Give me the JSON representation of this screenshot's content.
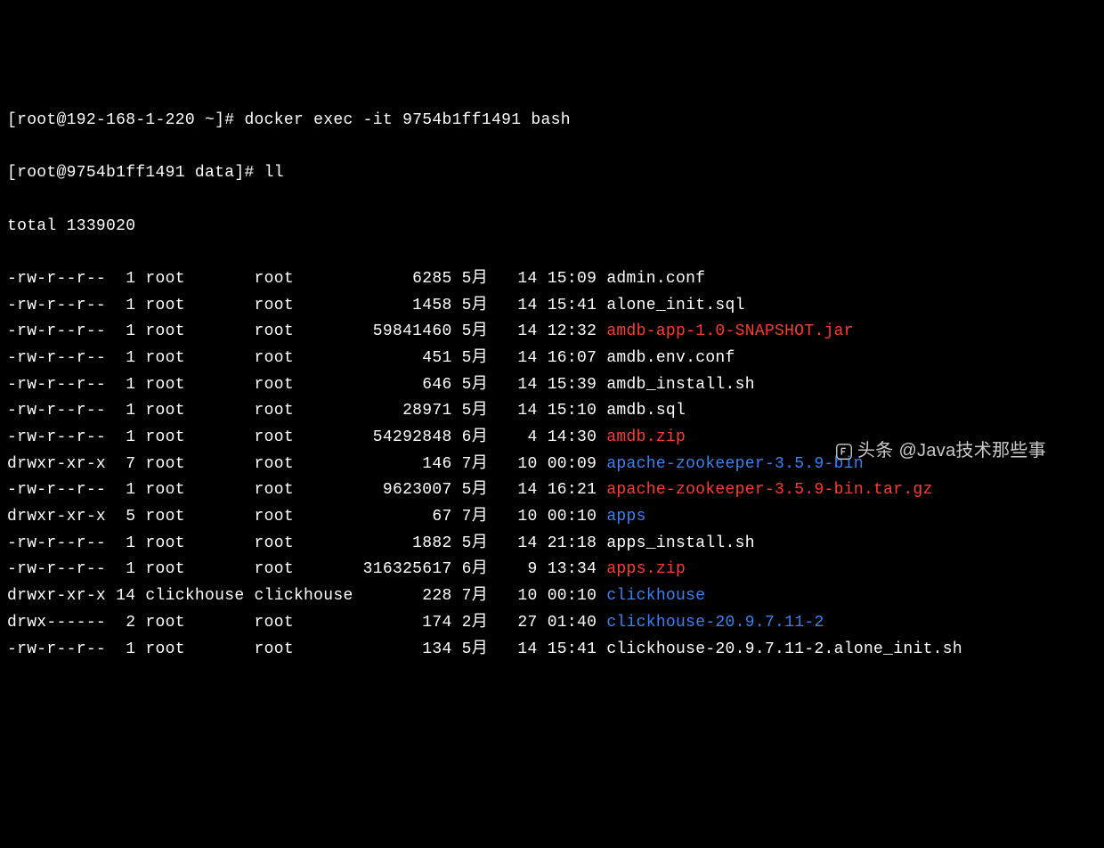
{
  "prompt1": "[root@192-168-1-220 ~]# docker exec -it 9754b1ff1491 bash",
  "prompt2": "[root@9754b1ff1491 data]# ll",
  "total": "total 1339020",
  "rows": [
    {
      "perm": "-rw-r--r--",
      "links": "1",
      "owner": "root",
      "group": "root",
      "size": "6285",
      "month": "5月",
      "day": "14",
      "time": "15:09",
      "name": "admin.conf",
      "color": ""
    },
    {
      "perm": "-rw-r--r--",
      "links": "1",
      "owner": "root",
      "group": "root",
      "size": "1458",
      "month": "5月",
      "day": "14",
      "time": "15:41",
      "name": "alone_init.sql",
      "color": ""
    },
    {
      "perm": "-rw-r--r--",
      "links": "1",
      "owner": "root",
      "group": "root",
      "size": "59841460",
      "month": "5月",
      "day": "14",
      "time": "12:32",
      "name": "amdb-app-1.0-SNAPSHOT.jar",
      "color": "red"
    },
    {
      "perm": "-rw-r--r--",
      "links": "1",
      "owner": "root",
      "group": "root",
      "size": "451",
      "month": "5月",
      "day": "14",
      "time": "16:07",
      "name": "amdb.env.conf",
      "color": ""
    },
    {
      "perm": "-rw-r--r--",
      "links": "1",
      "owner": "root",
      "group": "root",
      "size": "646",
      "month": "5月",
      "day": "14",
      "time": "15:39",
      "name": "amdb_install.sh",
      "color": ""
    },
    {
      "perm": "-rw-r--r--",
      "links": "1",
      "owner": "root",
      "group": "root",
      "size": "28971",
      "month": "5月",
      "day": "14",
      "time": "15:10",
      "name": "amdb.sql",
      "color": ""
    },
    {
      "perm": "-rw-r--r--",
      "links": "1",
      "owner": "root",
      "group": "root",
      "size": "54292848",
      "month": "6月",
      "day": "4",
      "time": "14:30",
      "name": "amdb.zip",
      "color": "red"
    },
    {
      "perm": "drwxr-xr-x",
      "links": "7",
      "owner": "root",
      "group": "root",
      "size": "146",
      "month": "7月",
      "day": "10",
      "time": "00:09",
      "name": "apache-zookeeper-3.5.9-bin",
      "color": "blue"
    },
    {
      "perm": "-rw-r--r--",
      "links": "1",
      "owner": "root",
      "group": "root",
      "size": "9623007",
      "month": "5月",
      "day": "14",
      "time": "16:21",
      "name": "apache-zookeeper-3.5.9-bin.tar.gz",
      "color": "red"
    },
    {
      "perm": "drwxr-xr-x",
      "links": "5",
      "owner": "root",
      "group": "root",
      "size": "67",
      "month": "7月",
      "day": "10",
      "time": "00:10",
      "name": "apps",
      "color": "blue"
    },
    {
      "perm": "-rw-r--r--",
      "links": "1",
      "owner": "root",
      "group": "root",
      "size": "1882",
      "month": "5月",
      "day": "14",
      "time": "21:18",
      "name": "apps_install.sh",
      "color": ""
    },
    {
      "perm": "-rw-r--r--",
      "links": "1",
      "owner": "root",
      "group": "root",
      "size": "316325617",
      "month": "6月",
      "day": "9",
      "time": "13:34",
      "name": "apps.zip",
      "color": "red"
    },
    {
      "perm": "drwxr-xr-x",
      "links": "14",
      "owner": "clickhouse",
      "group": "clickhouse",
      "size": "228",
      "month": "7月",
      "day": "10",
      "time": "00:10",
      "name": "clickhouse",
      "color": "blue"
    },
    {
      "perm": "drwx------",
      "links": "2",
      "owner": "root",
      "group": "root",
      "size": "174",
      "month": "2月",
      "day": "27",
      "time": "01:40",
      "name": "clickhouse-20.9.7.11-2",
      "color": "blue"
    },
    {
      "perm": "-rw-r--r--",
      "links": "1",
      "owner": "root",
      "group": "root",
      "size": "134",
      "month": "5月",
      "day": "14",
      "time": "15:41",
      "name": "clickhouse-20.9.7.11-2.alone_init.sh",
      "color": ""
    }
  ],
  "watermark": "头条 @Java技术那些事"
}
